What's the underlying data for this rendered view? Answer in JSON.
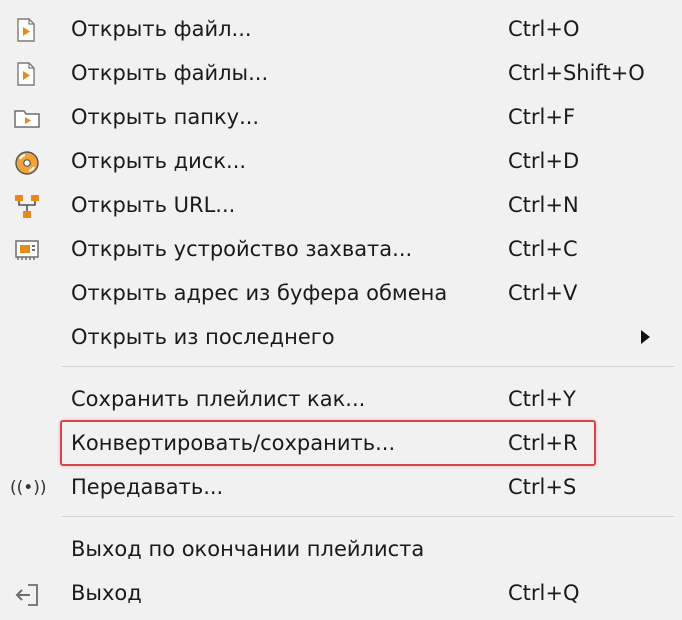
{
  "menu": {
    "items": [
      {
        "label": "Открыть файл...",
        "shortcut": "Ctrl+O",
        "icon": "media-file-icon"
      },
      {
        "label": "Открыть файлы...",
        "shortcut": "Ctrl+Shift+O",
        "icon": "media-files-icon"
      },
      {
        "label": "Открыть папку...",
        "shortcut": "Ctrl+F",
        "icon": "folder-icon"
      },
      {
        "label": "Открыть диск...",
        "shortcut": "Ctrl+D",
        "icon": "disc-icon"
      },
      {
        "label": "Открыть URL...",
        "shortcut": "Ctrl+N",
        "icon": "network-icon"
      },
      {
        "label": "Открыть устройство захвата...",
        "shortcut": "Ctrl+C",
        "icon": "capture-card-icon"
      },
      {
        "label": "Открыть адрес из буфера обмена",
        "shortcut": "Ctrl+V"
      },
      {
        "label": "Открыть из последнего",
        "has_submenu": true
      },
      {
        "label": "Сохранить плейлист как...",
        "shortcut": "Ctrl+Y"
      },
      {
        "label": "Конвертировать/сохранить...",
        "shortcut": "Ctrl+R",
        "highlighted": true
      },
      {
        "label": "Передавать...",
        "shortcut": "Ctrl+S",
        "icon": "broadcast-icon",
        "icon_text": "((•))"
      },
      {
        "label": "Выход по окончании плейлиста"
      },
      {
        "label": "Выход",
        "shortcut": "Ctrl+Q",
        "icon": "exit-icon"
      }
    ]
  },
  "colors": {
    "background": "#f1f1f1",
    "highlight_border": "#d8434a",
    "icon_orange": "#e8891c",
    "separator": "#d4d4d4"
  }
}
